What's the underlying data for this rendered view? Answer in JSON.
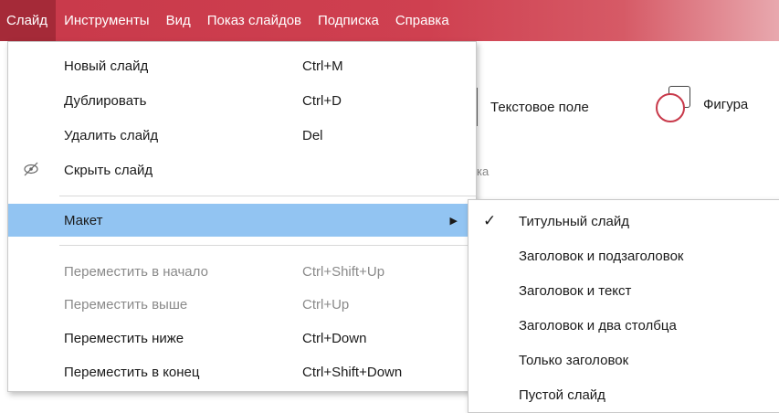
{
  "menubar": {
    "items": [
      {
        "label": "Слайд"
      },
      {
        "label": "Инструменты"
      },
      {
        "label": "Вид"
      },
      {
        "label": "Показ слайдов"
      },
      {
        "label": "Подписка"
      },
      {
        "label": "Справка"
      }
    ]
  },
  "toolbar": {
    "text_field_label": "Текстовое поле",
    "figure_label": "Фигура",
    "group_label": "ка"
  },
  "slide_menu": {
    "items": [
      {
        "label": "Новый слайд",
        "shortcut": "Ctrl+M"
      },
      {
        "label": "Дублировать",
        "shortcut": "Ctrl+D"
      },
      {
        "label": "Удалить слайд",
        "shortcut": "Del"
      },
      {
        "label": "Скрыть слайд",
        "shortcut": ""
      },
      {
        "label": "Макет",
        "shortcut": ""
      },
      {
        "label": "Переместить в начало",
        "shortcut": "Ctrl+Shift+Up"
      },
      {
        "label": "Переместить выше",
        "shortcut": "Ctrl+Up"
      },
      {
        "label": "Переместить ниже",
        "shortcut": "Ctrl+Down"
      },
      {
        "label": "Переместить в конец",
        "shortcut": "Ctrl+Shift+Down"
      }
    ]
  },
  "layout_submenu": {
    "items": [
      {
        "label": "Титульный слайд",
        "checked": true
      },
      {
        "label": "Заголовок и подзаголовок"
      },
      {
        "label": "Заголовок и текст"
      },
      {
        "label": "Заголовок и два столбца"
      },
      {
        "label": "Только заголовок"
      },
      {
        "label": "Пустой слайд"
      }
    ]
  },
  "colors": {
    "menubar": "#c8394a",
    "highlight": "#92c4f2"
  }
}
